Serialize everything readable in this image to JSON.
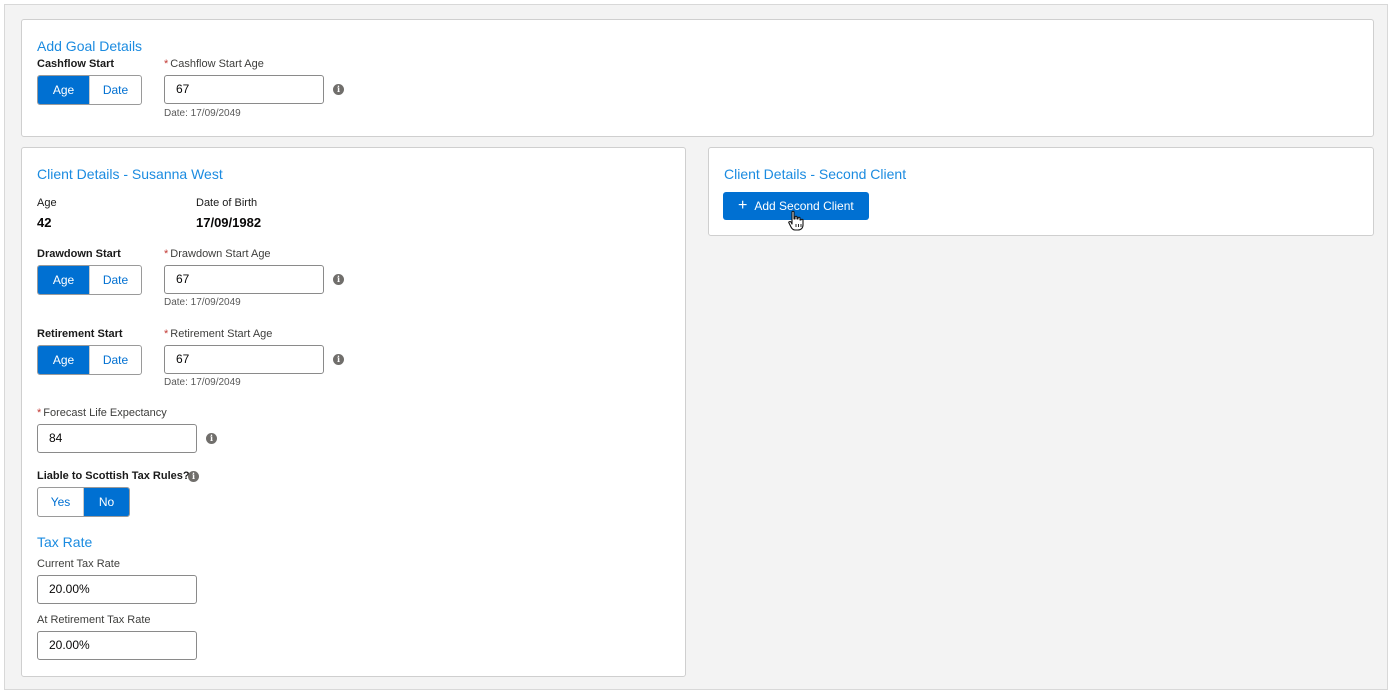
{
  "goal": {
    "title": "Add Goal Details",
    "cashflow_label": "Cashflow Start",
    "toggle": {
      "age": "Age",
      "date": "Date",
      "selected": "Age"
    },
    "age_field_label": "Cashflow Start Age",
    "age_value": "67",
    "date_helper": "Date: 17/09/2049",
    "info_glyph": "i"
  },
  "client": {
    "title": "Client Details - Susanna West",
    "age_label": "Age",
    "age_value": "42",
    "dob_label": "Date of Birth",
    "dob_value": "17/09/1982",
    "drawdown": {
      "label": "Drawdown Start",
      "toggle": {
        "age": "Age",
        "date": "Date",
        "selected": "Age"
      },
      "field_label": "Drawdown Start Age",
      "value": "67",
      "date_helper": "Date: 17/09/2049"
    },
    "retirement": {
      "label": "Retirement Start",
      "toggle": {
        "age": "Age",
        "date": "Date",
        "selected": "Age"
      },
      "field_label": "Retirement Start Age",
      "value": "67",
      "date_helper": "Date: 17/09/2049"
    },
    "life_expectancy": {
      "label": "Forecast Life Expectancy",
      "value": "84"
    },
    "scottish": {
      "label": "Liable to Scottish Tax Rules?",
      "toggle": {
        "yes": "Yes",
        "no": "No",
        "selected": "No"
      }
    },
    "tax": {
      "title": "Tax Rate",
      "current_label": "Current Tax Rate",
      "current_value": "20.00%",
      "retirement_label": "At Retirement Tax Rate",
      "retirement_value": "20.00%"
    }
  },
  "second_client": {
    "title": "Client Details - Second Client",
    "add_button_label": "Add Second Client",
    "plus_glyph": "+"
  },
  "colors": {
    "brand": "#0070d2",
    "title": "#1b8be0",
    "required": "#c23934"
  },
  "icons": [
    "info-icon",
    "plus-icon",
    "hand-cursor-icon"
  ]
}
